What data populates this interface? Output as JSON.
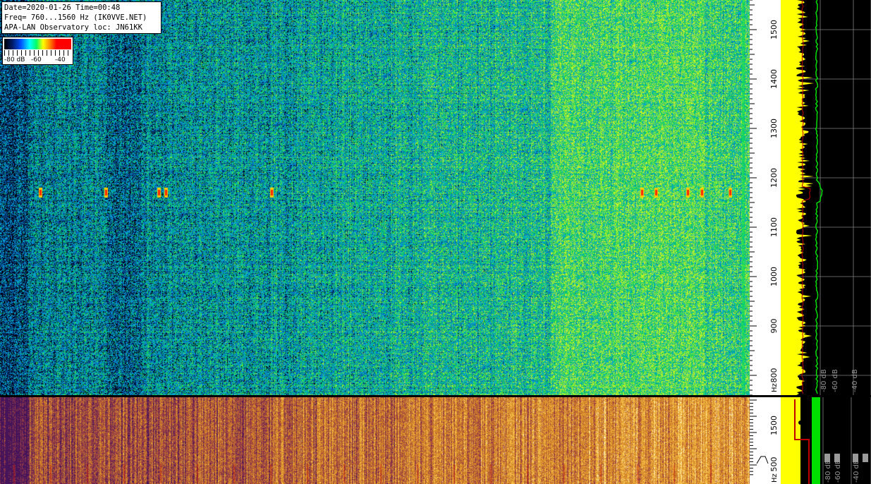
{
  "info": {
    "line1": "Date=2020-01-26 Time=00:48",
    "line2": "Freq= 760...1560 Hz (IK0VVE.NET)",
    "line3": "APA-LAN Observatory loc: JN61KK"
  },
  "colorbar": {
    "label_left": "-80 dB",
    "label_mid": "-60",
    "label_right": "-40"
  },
  "freq_scale_top": {
    "labels": [
      "1500",
      "1400",
      "1300",
      "1200",
      "1100",
      "1000",
      "900",
      "800"
    ],
    "unit": "Hz"
  },
  "freq_scale_bottom": {
    "labels": [
      "1500",
      "500"
    ],
    "unit": "Hz"
  },
  "spectrum_top_labels": [
    "-80 dB",
    "-60 dB",
    "-40 dB"
  ],
  "spectrum_bottom_labels": [
    "-80 dB",
    "-60 dB",
    "-40 dB"
  ],
  "colors": {
    "spectrum_yellow": "#ffff00",
    "spectrum_green": "#00e000",
    "spectrum_red": "#c00000",
    "grid": "#808080"
  }
}
